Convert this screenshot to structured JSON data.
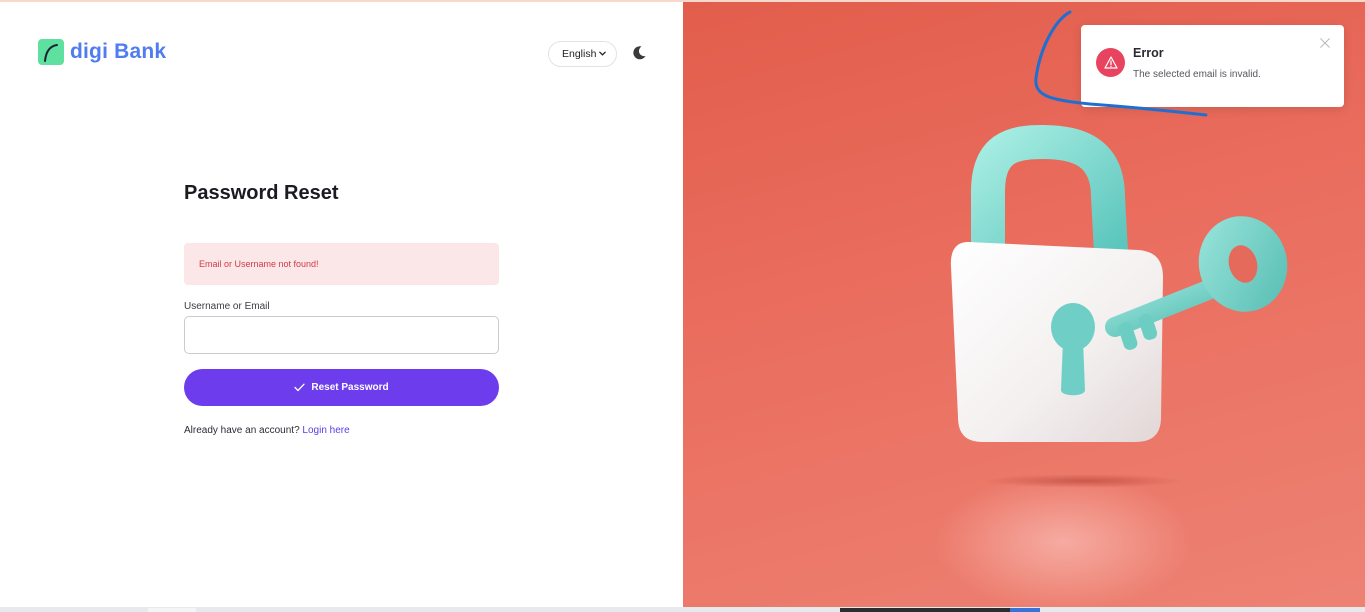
{
  "header": {
    "logo_text": "digi Bank",
    "language_label": "English",
    "theme_icon": "moon-icon"
  },
  "form": {
    "title": "Password Reset",
    "alert_text": "Email or Username not found!",
    "field_label": "Username or Email",
    "field_value": "",
    "submit_label": "Reset Password",
    "login_prompt": "Already have an account?",
    "login_link": "Login here"
  },
  "toast": {
    "title": "Error",
    "message": "The selected email is invalid.",
    "icon": "warning-icon",
    "close_icon": "close-icon"
  },
  "colors": {
    "brand": "#4f7cf0",
    "accent": "#6d3ced",
    "error": "#d23b47",
    "hero_bg": "#e8685a"
  }
}
